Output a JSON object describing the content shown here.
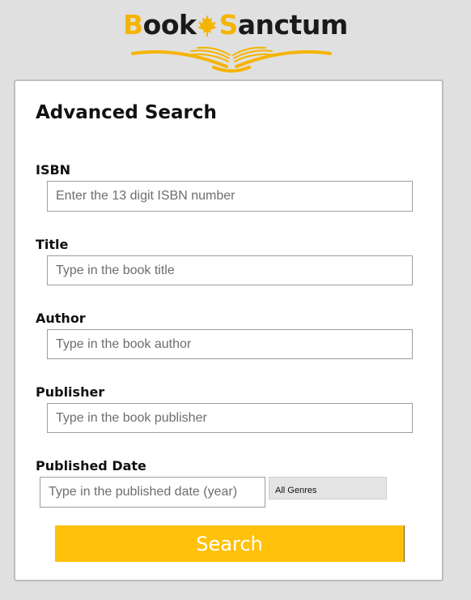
{
  "brand": {
    "name_part1_initial": "B",
    "name_part1_rest": "ook",
    "name_part2_initial": "S",
    "name_part2_rest": "anctum",
    "logo_icons": [
      "maple-leaf-icon",
      "open-book-icon"
    ],
    "accent_color": "#f5b400"
  },
  "form": {
    "title": "Advanced Search",
    "isbn": {
      "label": "ISBN",
      "placeholder": "Enter the 13 digit ISBN number",
      "value": ""
    },
    "title_field": {
      "label": "Title",
      "placeholder": "Type in the book title",
      "value": ""
    },
    "author": {
      "label": "Author",
      "placeholder": "Type in the book author",
      "value": ""
    },
    "publisher": {
      "label": "Publisher",
      "placeholder": "Type in the book publisher",
      "value": ""
    },
    "published_date": {
      "label": "Published Date",
      "placeholder": "Type in the published date (year)",
      "value": ""
    },
    "genre": {
      "selected": "All Genres"
    },
    "search_button": {
      "label": "Search",
      "color": "#ffc10a"
    }
  }
}
